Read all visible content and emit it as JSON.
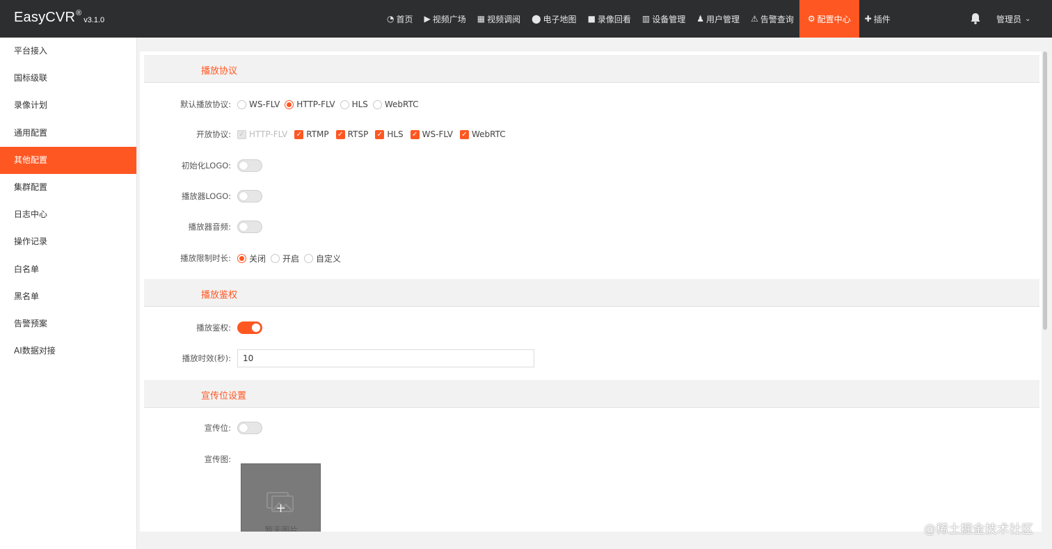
{
  "header": {
    "brand": "EasyCVR",
    "brand_reg": "®",
    "version": "v3.1.0",
    "nav": [
      {
        "label": "首页",
        "icon": "dashboard-icon",
        "glyph": "◔"
      },
      {
        "label": "视频广场",
        "icon": "play-circle-icon",
        "glyph": "▶"
      },
      {
        "label": "视频调阅",
        "icon": "table-icon",
        "glyph": "▦"
      },
      {
        "label": "电子地图",
        "icon": "map-marker-icon",
        "glyph": "⬤"
      },
      {
        "label": "录像回看",
        "icon": "video-camera-icon",
        "glyph": "■"
      },
      {
        "label": "设备管理",
        "icon": "columns-icon",
        "glyph": "▥"
      },
      {
        "label": "用户管理",
        "icon": "user-icon",
        "glyph": "♟"
      },
      {
        "label": "告警查询",
        "icon": "alarm-icon",
        "glyph": "⚠"
      },
      {
        "label": "配置中心",
        "icon": "gear-icon",
        "glyph": "⚙"
      },
      {
        "label": "插件",
        "icon": "puzzle-icon",
        "glyph": "✚"
      }
    ],
    "bell_icon": "bell-icon",
    "user": "管理员",
    "accent_color": "#ff5722"
  },
  "sidebar": {
    "items": [
      "平台接入",
      "国标级联",
      "录像计划",
      "通用配置",
      "其他配置",
      "集群配置",
      "日志中心",
      "操作记录",
      "白名单",
      "黑名单",
      "告警预案",
      "AI数据对接"
    ],
    "active": "其他配置"
  },
  "sections": {
    "play_protocol": {
      "title": "播放协议",
      "default_protocol": {
        "label": "默认播放协议:",
        "options": [
          "WS-FLV",
          "HTTP-FLV",
          "HLS",
          "WebRTC"
        ],
        "selected": "HTTP-FLV"
      },
      "open_protocol": {
        "label": "开放协议:",
        "options": [
          "HTTP-FLV",
          "RTMP",
          "RTSP",
          "HLS",
          "WS-FLV",
          "WebRTC"
        ]
      },
      "init_logo": {
        "label": "初始化LOGO:",
        "on": false
      },
      "player_logo": {
        "label": "播放器LOGO:",
        "on": false
      },
      "player_audio": {
        "label": "播放器音频:",
        "on": false
      },
      "play_limit": {
        "label": "播放限制时长:",
        "options": [
          "关闭",
          "开启",
          "自定义"
        ],
        "selected": "关闭"
      }
    },
    "play_auth": {
      "title": "播放鉴权",
      "auth": {
        "label": "播放鉴权:",
        "on": true
      },
      "expiry": {
        "label": "播放时效(秒):",
        "value": "10"
      }
    },
    "promo": {
      "title": "宣传位设置",
      "promo_switch": {
        "label": "宣传位:",
        "on": false
      },
      "promo_image": {
        "label": "宣传图:",
        "empty_text": "暂无图片"
      }
    }
  },
  "watermark": "@稀土掘金技术社区"
}
